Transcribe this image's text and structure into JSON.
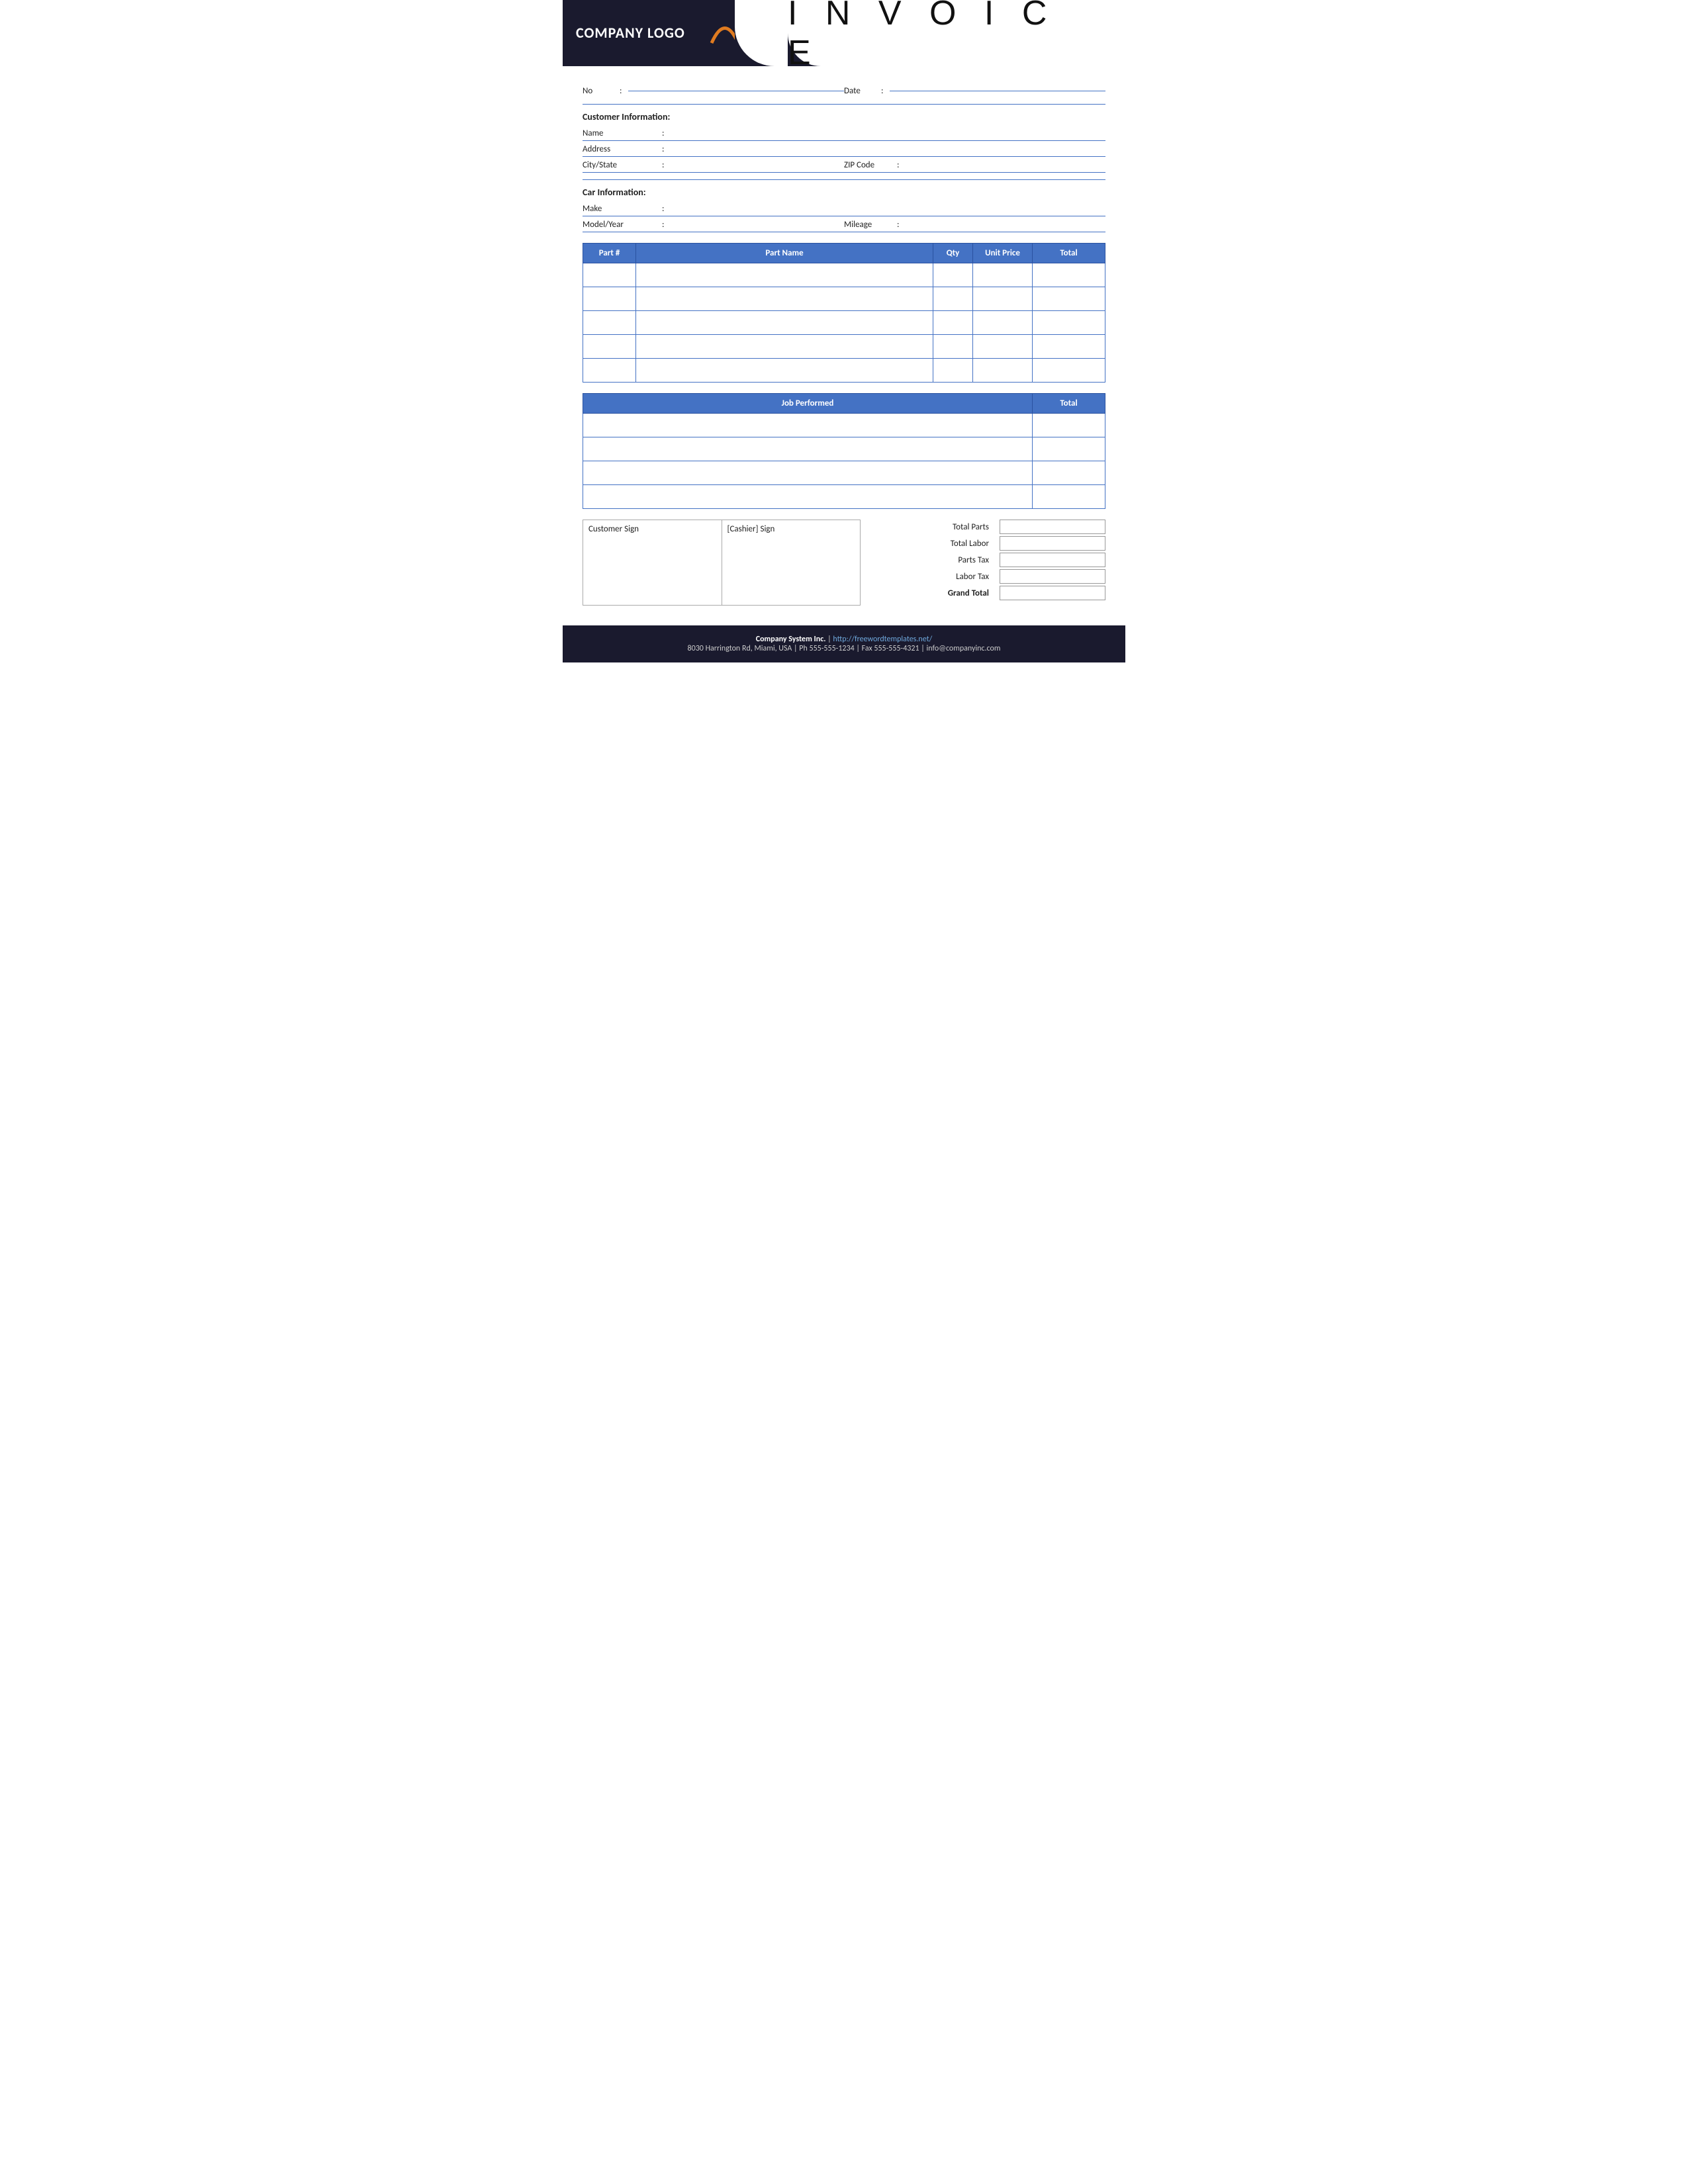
{
  "header": {
    "logo_text": "COMPANY LOGO",
    "invoice_title": "I N V O I C E"
  },
  "invoice_meta": {
    "no_label": "No",
    "no_colon": ":",
    "date_label": "Date",
    "date_colon": ":"
  },
  "customer_section": {
    "title": "Customer Information:",
    "name_label": "Name",
    "name_colon": ":",
    "address_label": "Address",
    "address_colon": ":",
    "city_label": "City/State",
    "city_colon": ":",
    "zip_label": "ZIP Code",
    "zip_colon": ":"
  },
  "car_section": {
    "title": "Car Information:",
    "make_label": "Make",
    "make_colon": ":",
    "model_label": "Model/Year",
    "model_colon": ":",
    "mileage_label": "Mileage",
    "mileage_colon": ":"
  },
  "parts_table": {
    "col_part": "Part #",
    "col_name": "Part Name",
    "col_qty": "Qty",
    "col_unit": "Unit Price",
    "col_total": "Total",
    "rows": [
      {
        "part": "",
        "name": "",
        "qty": "",
        "unit": "",
        "total": ""
      },
      {
        "part": "",
        "name": "",
        "qty": "",
        "unit": "",
        "total": ""
      },
      {
        "part": "",
        "name": "",
        "qty": "",
        "unit": "",
        "total": ""
      },
      {
        "part": "",
        "name": "",
        "qty": "",
        "unit": "",
        "total": ""
      },
      {
        "part": "",
        "name": "",
        "qty": "",
        "unit": "",
        "total": ""
      }
    ]
  },
  "job_table": {
    "col_job": "Job Performed",
    "col_total": "Total",
    "rows": [
      {
        "job": "",
        "total": ""
      },
      {
        "job": "",
        "total": ""
      },
      {
        "job": "",
        "total": ""
      },
      {
        "job": "",
        "total": ""
      }
    ]
  },
  "signatures": {
    "customer_sign": "Customer Sign",
    "cashier_sign": "[Cashier] Sign"
  },
  "totals": {
    "total_parts_label": "Total Parts",
    "total_labor_label": "Total Labor",
    "parts_tax_label": "Parts Tax",
    "labor_tax_label": "Labor Tax",
    "grand_total_label": "Grand Total"
  },
  "footer": {
    "company": "Company System Inc.",
    "separator": "|",
    "website": "http://freewordtemplates.net/",
    "address": "8030 Harrington Rd, Miami, USA | Ph 555-555-1234 | Fax 555-555-4321 | info@companyinc.com"
  }
}
